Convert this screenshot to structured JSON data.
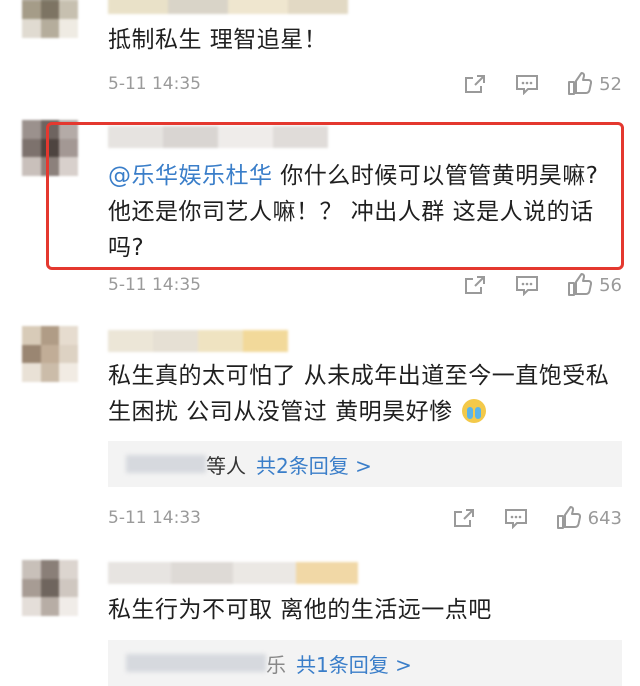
{
  "comments": [
    {
      "text": "抵制私生 理智追星！",
      "time": "5-11 14:35",
      "likes": "52"
    },
    {
      "mention": "@乐华娱乐杜华",
      "text_line1": " 你什么时候可以管管黄明昊嘛?",
      "text_line2": "他还是你司艺人嘛！？ 冲出人群 这是人说的话",
      "text_line3": "吗?",
      "time": "5-11 14:35",
      "likes": "56"
    },
    {
      "text_line1": "私生真的太可怕了 从未成年出道至今一直饱受私",
      "text_line2": "生困扰 公司从没管过 黄明昊好惨",
      "emoji": "crying-emoji",
      "reply_prefix": "等人",
      "reply_link": "共2条回复 >",
      "time": "5-11 14:33",
      "likes": "643"
    },
    {
      "text": "私生行为不可取 离他的生活远一点吧",
      "reply_prefix": "乐",
      "reply_link": "共1条回复 >"
    }
  ],
  "colors": {
    "link": "#3a7ec9",
    "highlight_border": "#e4382f",
    "meta_gray": "#9a9a9a"
  },
  "icons": [
    "share-icon",
    "comment-icon",
    "like-icon"
  ]
}
